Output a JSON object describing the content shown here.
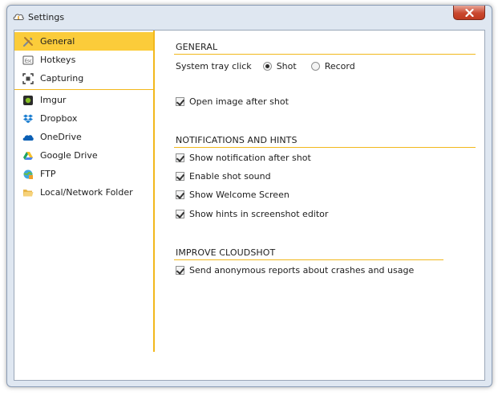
{
  "window": {
    "title": "Settings"
  },
  "sidebar": {
    "general_items": [
      {
        "label": "General",
        "icon": "tools-icon",
        "active": true
      },
      {
        "label": "Hotkeys",
        "icon": "keyboard-esc-icon",
        "active": false
      },
      {
        "label": "Capturing",
        "icon": "capture-frame-icon",
        "active": false
      }
    ],
    "cloud_items": [
      {
        "label": "Imgur",
        "icon": "imgur-icon"
      },
      {
        "label": "Dropbox",
        "icon": "dropbox-icon"
      },
      {
        "label": "OneDrive",
        "icon": "onedrive-icon"
      },
      {
        "label": "Google Drive",
        "icon": "google-drive-icon"
      },
      {
        "label": "FTP",
        "icon": "ftp-icon"
      },
      {
        "label": "Local/Network Folder",
        "icon": "folder-icon"
      }
    ]
  },
  "general": {
    "title": "GENERAL",
    "tray_label": "System tray click",
    "tray_options": [
      {
        "label": "Shot",
        "selected": true
      },
      {
        "label": "Record",
        "selected": false
      }
    ],
    "open_image_label": "Open image after shot",
    "open_image_checked": true
  },
  "notifications": {
    "title": "NOTIFICATIONS AND HINTS",
    "items": [
      {
        "label": "Show notification after shot",
        "checked": true
      },
      {
        "label": "Enable shot sound",
        "checked": true
      },
      {
        "label": "Show Welcome Screen",
        "checked": true
      },
      {
        "label": "Show hints in screenshot editor",
        "checked": true
      }
    ]
  },
  "improve": {
    "title": "IMPROVE CLOUDSHOT",
    "reports_label": "Send anonymous reports about crashes and usage",
    "reports_checked": true
  },
  "colors": {
    "accent": "#f2b81c",
    "active_item": "#fbcc3a",
    "frame": "#dfe7f1"
  }
}
